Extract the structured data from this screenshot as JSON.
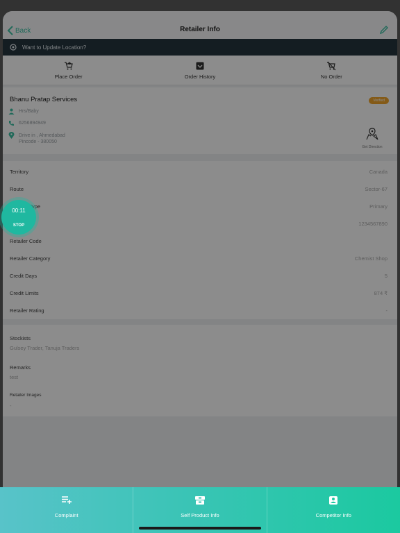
{
  "header": {
    "back_label": "Back",
    "title": "Retailer Info"
  },
  "location_bar": {
    "text": "Want to Update Location?"
  },
  "actions": [
    {
      "label": "Place Order",
      "icon": "cart-plus-icon"
    },
    {
      "label": "Order History",
      "icon": "order-history-icon"
    },
    {
      "label": "No Order",
      "icon": "cart-off-icon"
    }
  ],
  "retailer": {
    "name": "Bhanu Pratap Services",
    "status": "Verified",
    "contact_person": "Hrs/Baby",
    "phone": "6256894949",
    "address_line1": "Drive in , Ahmedabad",
    "address_line2": "Pincode - 380050",
    "direction_label": "Get Direction"
  },
  "details": [
    {
      "key": "Territory",
      "value": "Canada"
    },
    {
      "key": "Route",
      "value": "Sector-67"
    },
    {
      "key": "Retailer Type",
      "value": "Primary"
    },
    {
      "key": "GSTIN",
      "value": "1234567890"
    },
    {
      "key": "Retailer Code",
      "value": ""
    },
    {
      "key": "Retailer Category",
      "value": "Chemist Shop"
    },
    {
      "key": "Credit Days",
      "value": "5"
    },
    {
      "key": "Credit Limits",
      "value": "874 ₹"
    },
    {
      "key": "Retailer Rating",
      "value": "-"
    }
  ],
  "stockists": {
    "label": "Stockists",
    "value": "Gulsey Trader, Tanuja Traders"
  },
  "remarks": {
    "label": "Remarks",
    "value": "test"
  },
  "retailer_images": {
    "label": "Retailer Images",
    "value": "-"
  },
  "timer": {
    "time": "00:11",
    "stop_label": "STOP"
  },
  "bottom_bar": [
    {
      "label": "Complaint",
      "icon": "complaint-list-icon"
    },
    {
      "label": "Self Product Info",
      "icon": "product-box-icon"
    },
    {
      "label": "Competitor Info",
      "icon": "competitor-badge-icon"
    }
  ],
  "colors": {
    "accent": "#3bbfa3",
    "location_bar": "#26353f",
    "badge": "#f0a52b",
    "timer": "#1fb8a0"
  }
}
